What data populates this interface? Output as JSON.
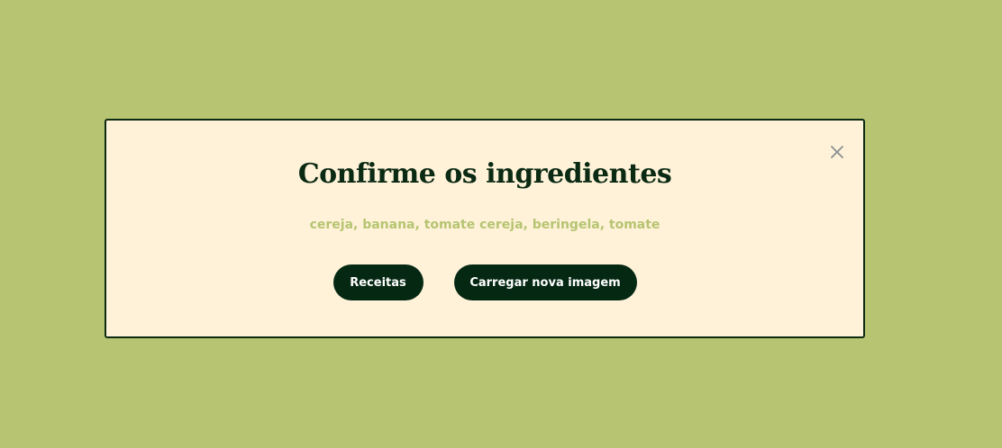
{
  "modal": {
    "title": "Confirme os ingredientes",
    "ingredients_text": "cereja, banana, tomate cereja, beringela, tomate",
    "close_icon": "close-icon",
    "buttons": {
      "recipes_label": "Receitas",
      "upload_label": "Carregar nova imagem"
    }
  },
  "colors": {
    "background": "#b7c573",
    "modal_background": "#fff2d8",
    "primary_dark": "#052813",
    "ingredients_text": "#b6c472"
  }
}
